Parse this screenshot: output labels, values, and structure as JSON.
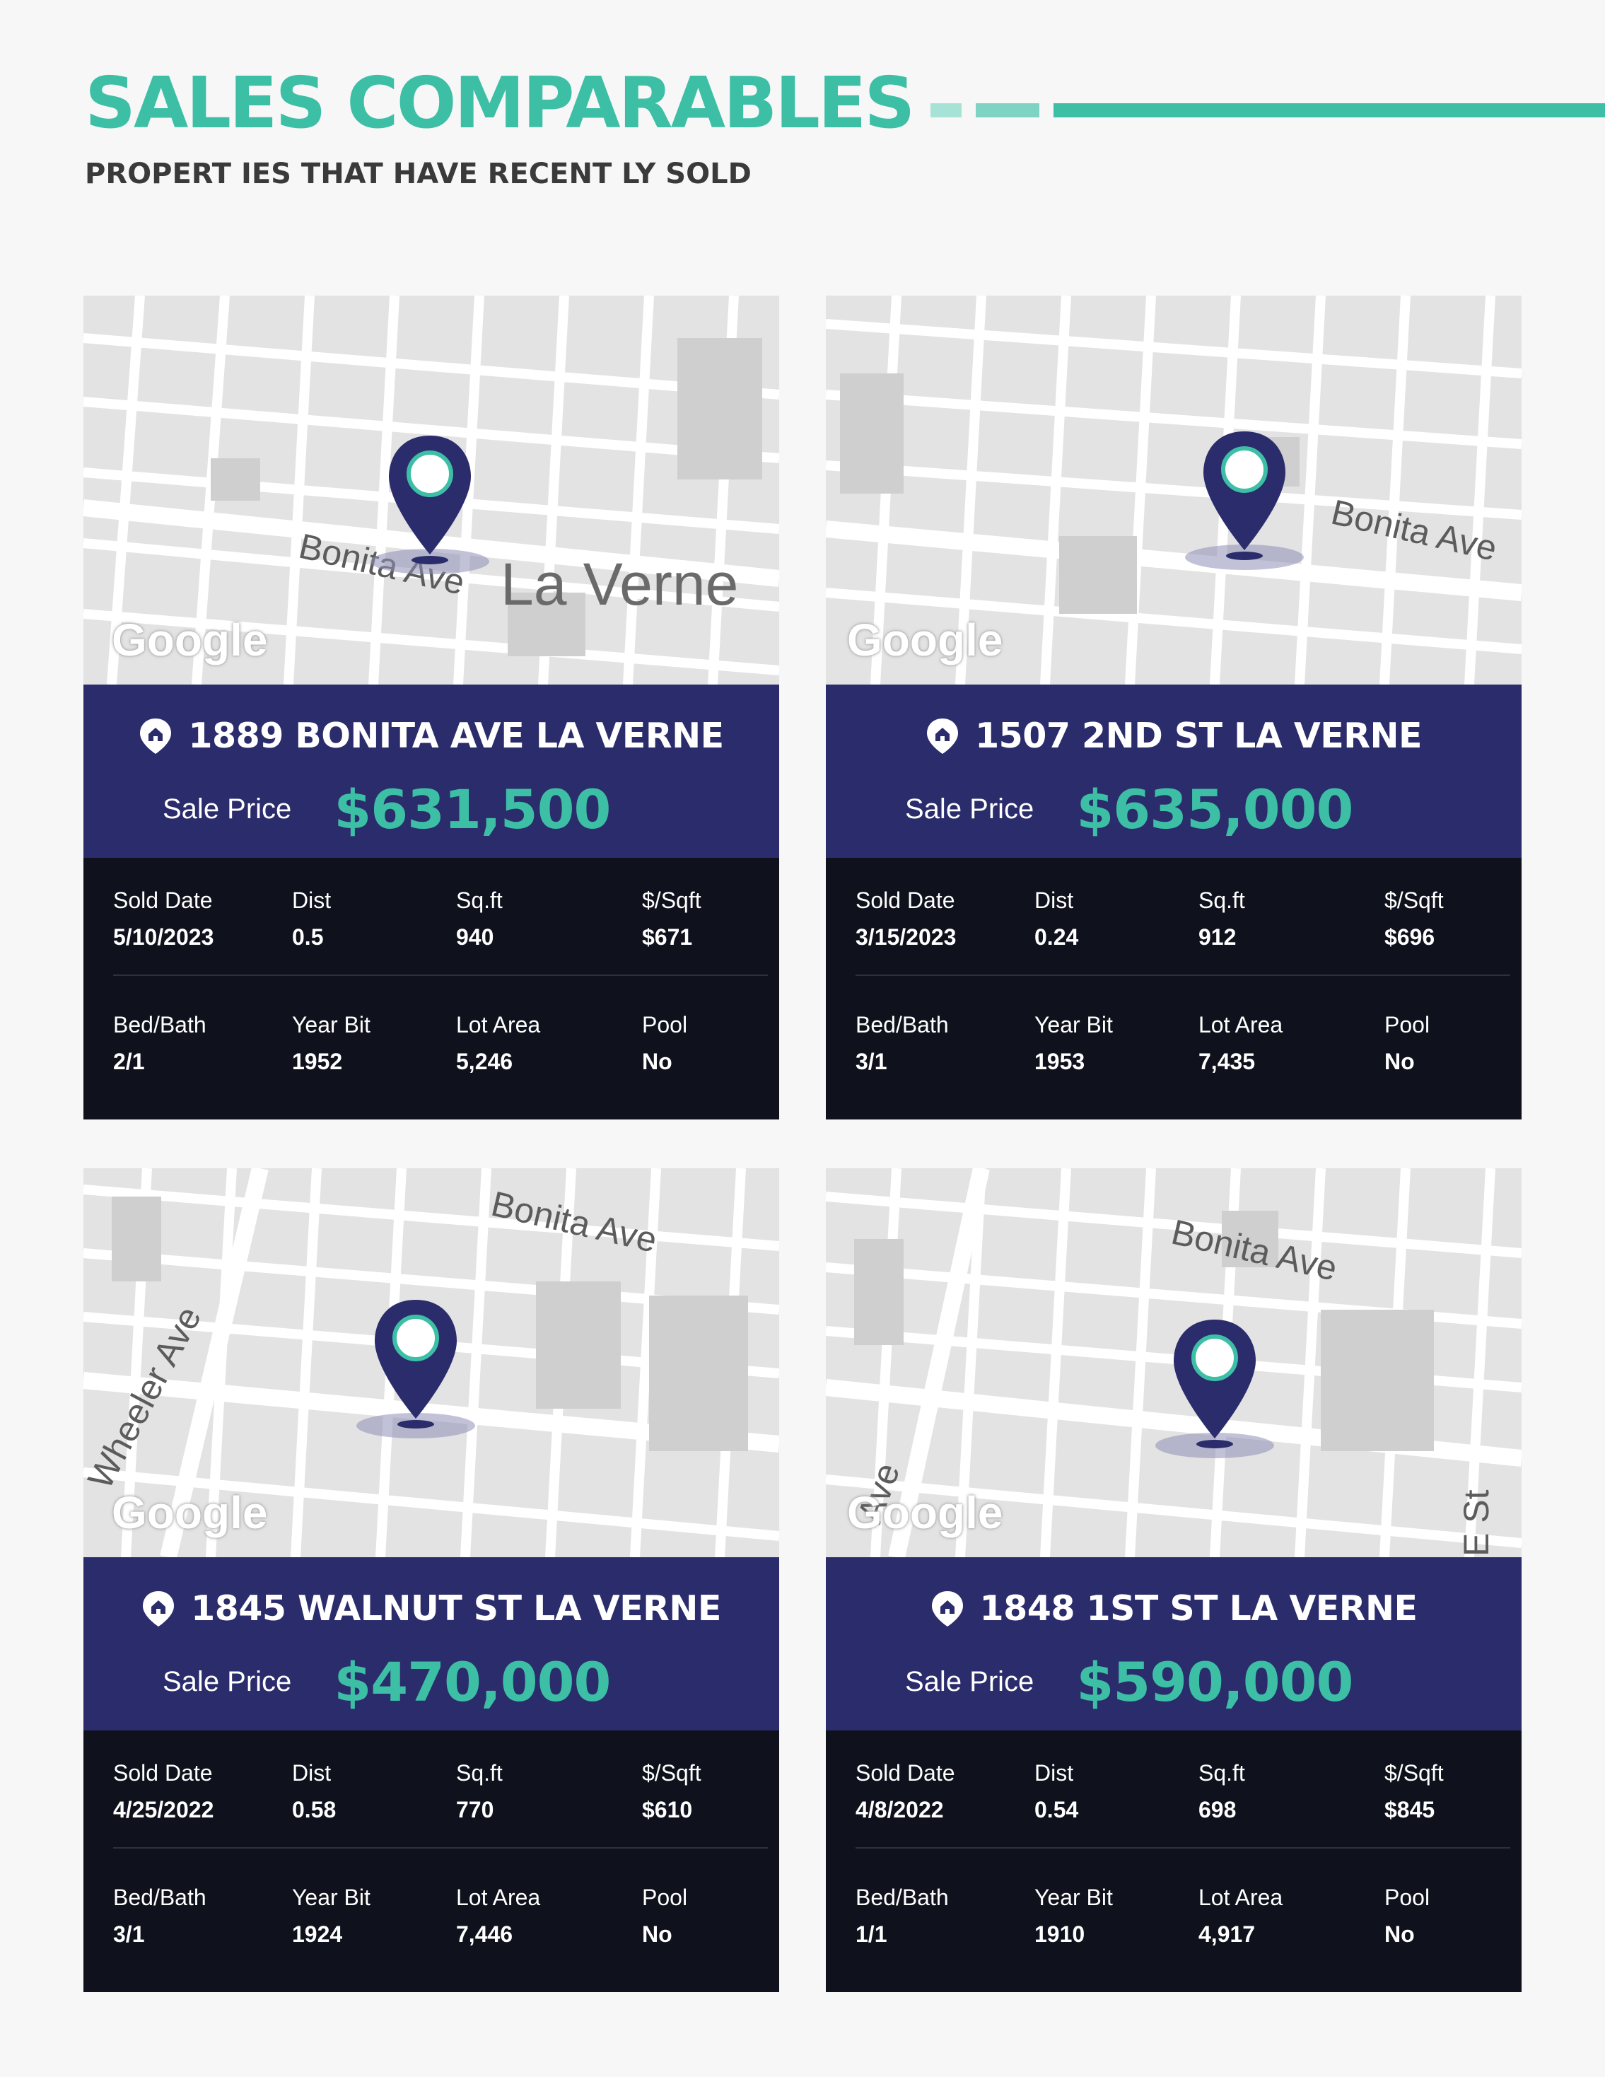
{
  "header": {
    "title": "SALES COMPARABLES",
    "subtitle": "PROPERT IES THAT HAVE RECENT LY SOLD"
  },
  "labels": {
    "sale_price": "Sale Price",
    "sold_date": "Sold Date",
    "dist": "Dist",
    "sqft": "Sq.ft",
    "price_per_sqft": "$/Sqft",
    "bed_bath": "Bed/Bath",
    "year_built": "Year Bit",
    "lot_area": "Lot Area",
    "pool": "Pool"
  },
  "colors": {
    "accent": "#3dbfa6",
    "band": "#2b2c6b",
    "details_bg": "#0f121c",
    "pin": "#2b2c6b"
  },
  "cards": [
    {
      "address": "1889 BONITA AVE LA VERNE",
      "sale_price": "$631,500",
      "sold_date": "5/10/2023",
      "dist": "0.5",
      "sqft": "940",
      "price_per_sqft": "$671",
      "bed_bath": "2/1",
      "year_built": "1952",
      "lot_area": "5,246",
      "pool": "No",
      "map": {
        "road_label": "Bonita Ave",
        "city_label": "La Verne",
        "watermark": "Google"
      }
    },
    {
      "address": "1507 2ND ST LA VERNE",
      "sale_price": "$635,000",
      "sold_date": "3/15/2023",
      "dist": "0.24",
      "sqft": "912",
      "price_per_sqft": "$696",
      "bed_bath": "3/1",
      "year_built": "1953",
      "lot_area": "7,435",
      "pool": "No",
      "map": {
        "road_label": "Bonita Ave",
        "watermark": "Google"
      }
    },
    {
      "address": "1845 WALNUT ST LA VERNE",
      "sale_price": "$470,000",
      "sold_date": "4/25/2022",
      "dist": "0.58",
      "sqft": "770",
      "price_per_sqft": "$610",
      "bed_bath": "3/1",
      "year_built": "1924",
      "lot_area": "7,446",
      "pool": "No",
      "map": {
        "road_label": "Bonita Ave",
        "side_label": "Wheeler Ave",
        "watermark": "Google"
      }
    },
    {
      "address": "1848 1ST ST LA VERNE",
      "sale_price": "$590,000",
      "sold_date": "4/8/2022",
      "dist": "0.54",
      "sqft": "698",
      "price_per_sqft": "$845",
      "bed_bath": "1/1",
      "year_built": "1910",
      "lot_area": "4,917",
      "pool": "No",
      "map": {
        "road_label": "Bonita Ave",
        "side_label": "Ave",
        "corner_label": "E St",
        "watermark": "Google"
      }
    }
  ]
}
